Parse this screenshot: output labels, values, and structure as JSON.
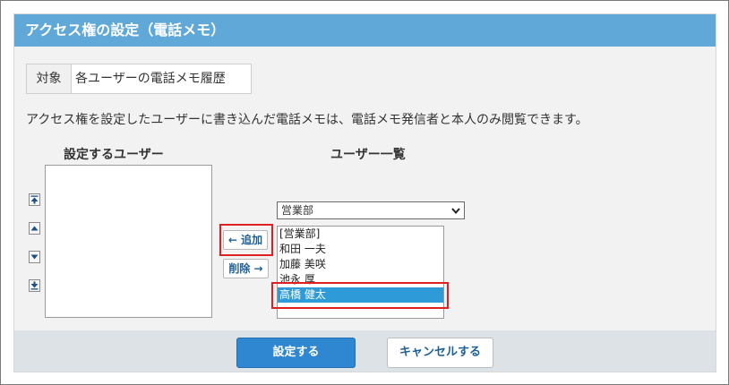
{
  "title": "アクセス権の設定（電話メモ）",
  "target": {
    "label": "対象",
    "value": "各ユーザーの電話メモ履歴"
  },
  "description": "アクセス権を設定したユーザーに書き込んだ電話メモは、電話メモ発信者と本人のみ閲覧できます。",
  "selected_users": {
    "heading": "設定するユーザー",
    "items": []
  },
  "user_list": {
    "heading": "ユーザー一覧",
    "group_select": "営業部",
    "items": [
      {
        "label": "[営業部]",
        "selected": false
      },
      {
        "label": "和田 一夫",
        "selected": false
      },
      {
        "label": "加藤 美咲",
        "selected": false
      },
      {
        "label": "池永 厚",
        "selected": false
      },
      {
        "label": "高橋 健太",
        "selected": true
      }
    ]
  },
  "actions": {
    "add": "← 追加",
    "remove": "削除 →"
  },
  "footer": {
    "submit": "設定する",
    "cancel": "キャンセルする"
  },
  "colors": {
    "title_bar": "#5fa8d8",
    "primary_button": "#2f86d1",
    "selection": "#2e9bd8",
    "highlight_box": "#e02020"
  }
}
